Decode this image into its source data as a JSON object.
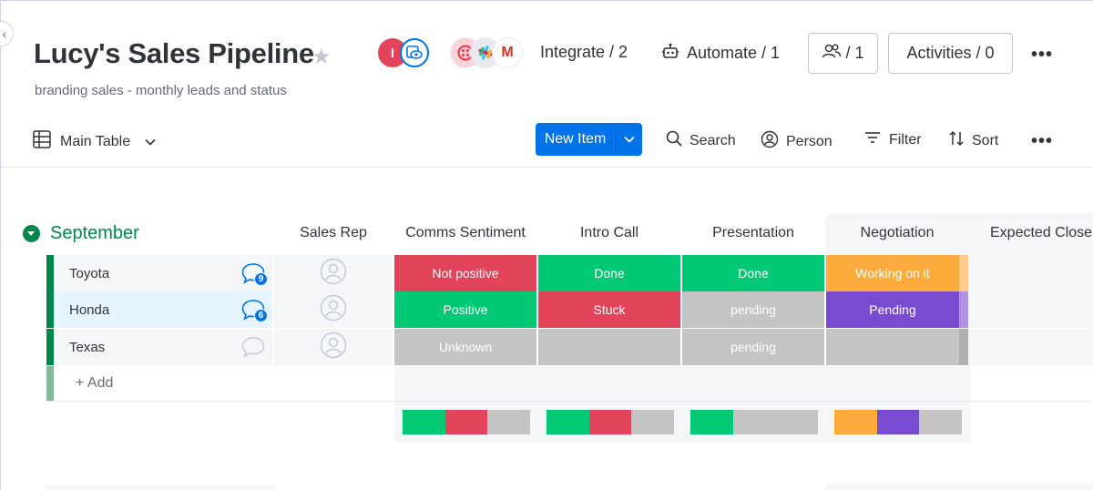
{
  "board": {
    "title": "Lucy's Sales Pipeline",
    "description": "branding sales - monthly leads and status"
  },
  "header": {
    "avatar_initial": "I",
    "integrate_label": "Integrate / 2",
    "automate_label": "Automate / 1",
    "members_label": "/ 1",
    "activities_label": "Activities / 0",
    "gmail_letter": "M"
  },
  "toolbar": {
    "view_label": "Main Table",
    "new_item_label": "New Item",
    "search_label": "Search",
    "person_label": "Person",
    "filter_label": "Filter",
    "sort_label": "Sort"
  },
  "group": {
    "name": "September",
    "color": "#00854d"
  },
  "columns": [
    "Sales Rep",
    "Comms Sentiment",
    "Intro Call",
    "Presentation",
    "Negotiation",
    "Expected Close"
  ],
  "rows": [
    {
      "name": "Toyota",
      "updates": "9",
      "cells": [
        {
          "label": "Not positive",
          "color": "#e2445c"
        },
        {
          "label": "Done",
          "color": "#00c875"
        },
        {
          "label": "Done",
          "color": "#00c875"
        },
        {
          "label": "Working on it",
          "color": "#fdab3d"
        }
      ]
    },
    {
      "name": "Honda",
      "updates": "6",
      "cells": [
        {
          "label": "Positive",
          "color": "#00c875"
        },
        {
          "label": "Stuck",
          "color": "#e2445c"
        },
        {
          "label": "pending",
          "color": "#c4c4c4"
        },
        {
          "label": "Pending",
          "color": "#784bd1"
        }
      ]
    },
    {
      "name": "Texas",
      "updates": "",
      "cells": [
        {
          "label": "Unknown",
          "color": "#c4c4c4"
        },
        {
          "label": "",
          "color": "#c4c4c4"
        },
        {
          "label": "pending",
          "color": "#c4c4c4"
        },
        {
          "label": "",
          "color": "#c4c4c4"
        }
      ]
    }
  ],
  "add_item_label": "+ Add",
  "summary": [
    [
      {
        "color": "#00c875",
        "fraction": 0.333
      },
      {
        "color": "#e2445c",
        "fraction": 0.333
      },
      {
        "color": "#c4c4c4",
        "fraction": 0.334
      }
    ],
    [
      {
        "color": "#00c875",
        "fraction": 0.333
      },
      {
        "color": "#e2445c",
        "fraction": 0.333
      },
      {
        "color": "#c4c4c4",
        "fraction": 0.334
      }
    ],
    [
      {
        "color": "#00c875",
        "fraction": 0.333
      },
      {
        "color": "#c4c4c4",
        "fraction": 0.667
      }
    ],
    [
      {
        "color": "#fdab3d",
        "fraction": 0.333
      },
      {
        "color": "#784bd1",
        "fraction": 0.333
      },
      {
        "color": "#c4c4c4",
        "fraction": 0.334
      }
    ]
  ],
  "icons": {
    "star": "star-icon",
    "table": "table-icon",
    "search": "search-icon",
    "person": "person-icon",
    "filter": "filter-icon",
    "sort": "sort-icon",
    "automate": "robot-icon",
    "members": "people-icon",
    "updates": "speech-bubble-icon"
  }
}
